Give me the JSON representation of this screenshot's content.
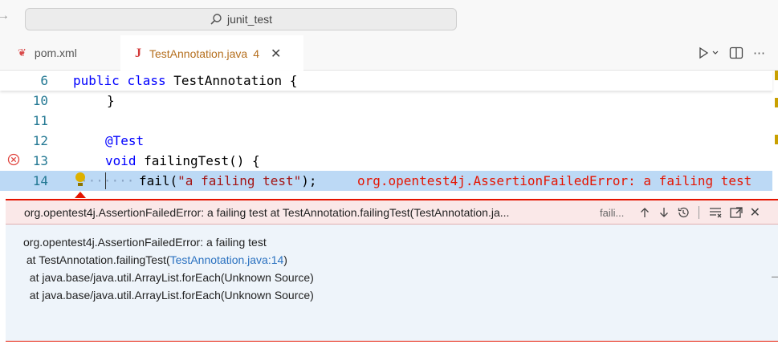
{
  "titlebar": {
    "back_glyph": "→",
    "search_text": "junit_test"
  },
  "tabs": [
    {
      "label": "pom.xml",
      "icon": "maven-feather-icon"
    },
    {
      "label": "TestAnnotation.java",
      "icon": "java-icon",
      "badge": "4",
      "close": "✕"
    }
  ],
  "editor": {
    "lines": [
      {
        "num": "6"
      },
      {
        "num": "10"
      },
      {
        "num": "11"
      },
      {
        "num": "12"
      },
      {
        "num": "13"
      },
      {
        "num": "14"
      }
    ],
    "code": {
      "l6_kw1": "public",
      "l6_kw2": "class",
      "l6_rest": " TestAnnotation {",
      "l10": "}",
      "l12_ann": "@Test",
      "l13_kw": "void",
      "l13_rest": " failingTest() {",
      "l14_fn": "fail(",
      "l14_str": "\"a failing test\"",
      "l14_end": ");",
      "l14_error": "org.opentest4j.AssertionFailedError: a failing test"
    }
  },
  "peek": {
    "title": "org.opentest4j.AssertionFailedError: a failing test at TestAnnotation.failingTest(TestAnnotation.ja...",
    "subtitle": "faili...",
    "stack": {
      "line1": "org.opentest4j.AssertionFailedError: a failing test",
      "line2_prefix": " at TestAnnotation.failingTest(",
      "line2_link": "TestAnnotation.java:14",
      "line2_suffix": ")",
      "line3": "  at java.base/java.util.ArrayList.forEach(Unknown Source)",
      "line4": "  at java.base/java.util.ArrayList.forEach(Unknown Source)"
    }
  },
  "colors": {
    "error": "#e51400",
    "keyword": "#0000ff",
    "string": "#a31515",
    "link": "#2a71c0",
    "line_number": "#237893"
  }
}
